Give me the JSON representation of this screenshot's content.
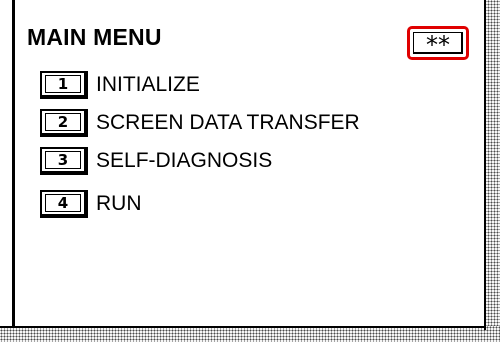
{
  "menu": {
    "title": "MAIN MENU",
    "indicator": "**",
    "items": [
      {
        "number": "1",
        "label": "INITIALIZE"
      },
      {
        "number": "2",
        "label": "SCREEN DATA TRANSFER"
      },
      {
        "number": "3",
        "label": "SELF-DIAGNOSIS"
      },
      {
        "number": "4",
        "label": "RUN"
      }
    ]
  },
  "colors": {
    "highlight": "#e00000",
    "ink": "#000000",
    "background": "#ffffff"
  }
}
